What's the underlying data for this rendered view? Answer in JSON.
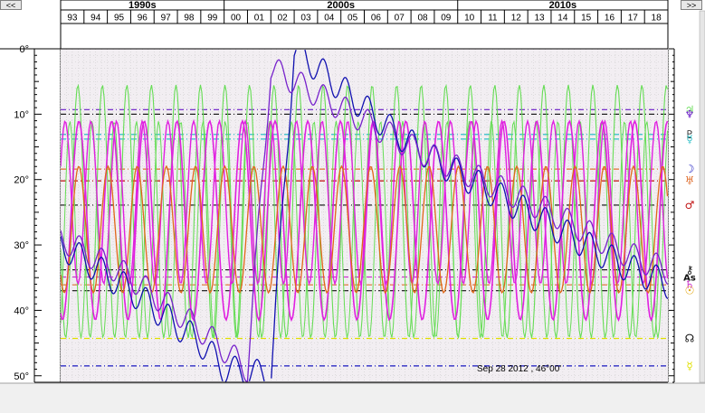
{
  "nav": {
    "prev_label": "<<",
    "next_label": ">>"
  },
  "decades": [
    "1990s",
    "2000s",
    "2010s"
  ],
  "years": [
    "93",
    "94",
    "95",
    "96",
    "97",
    "98",
    "99",
    "00",
    "01",
    "02",
    "03",
    "04",
    "05",
    "06",
    "07",
    "08",
    "09",
    "10",
    "11",
    "12",
    "13",
    "14",
    "15",
    "16",
    "17",
    "18"
  ],
  "status_text": "Sep 28 2012 ,  46°00'",
  "colors": {
    "plot_bg": "#f2eef2",
    "grid": "#c8c8c8",
    "magenta": "#e020e0",
    "orange": "#e06818",
    "green": "#66dd55",
    "blue": "#1010b0",
    "purple": "#7722cc"
  },
  "chart_data": {
    "type": "line",
    "x_range": [
      1993,
      2019
    ],
    "ylim": [
      0,
      51
    ],
    "y_ticks": [
      0,
      10,
      20,
      30,
      40,
      50
    ],
    "y_tick_labels": [
      "0°",
      "10°",
      "20°",
      "30°",
      "40°",
      "50°"
    ],
    "horizontal_lines": [
      {
        "value": 9.3,
        "color": "#6a1ac8",
        "glyph": "♃",
        "glyph_color": "#66dd55"
      },
      {
        "value": 10.0,
        "color": "#202020",
        "glyph": "♆",
        "glyph_color": "#6a1ac8"
      },
      {
        "value": 13.1,
        "color": "#30c0c8",
        "glyph": "♇",
        "glyph_color": "#222222"
      },
      {
        "value": 13.8,
        "color": "#30c0c8",
        "glyph": "☿",
        "glyph_color": "#30c0c8"
      },
      {
        "value": 18.4,
        "color": "#e07030",
        "glyph": "☽",
        "glyph_color": "#1818c0"
      },
      {
        "value": 20.2,
        "color": "#c01010",
        "glyph": "♅",
        "glyph_color": "#e07030"
      },
      {
        "value": 23.9,
        "color": "#111111",
        "glyph": "♂",
        "glyph_color": "#c01010"
      },
      {
        "value": 33.8,
        "color": "#111111",
        "glyph": "⚷",
        "glyph_color": "#111111"
      },
      {
        "value": 34.9,
        "color": "#cc33cc",
        "glyph": "As",
        "glyph_color": "#111111"
      },
      {
        "value": 36.1,
        "color": "#e07030",
        "glyph": "♄",
        "glyph_color": "#cc33cc"
      },
      {
        "value": 37.0,
        "color": "#111111",
        "glyph": "☉",
        "glyph_color": "#e0a000"
      },
      {
        "value": 44.3,
        "color": "#e0e000",
        "glyph": "☊",
        "glyph_color": "#111111"
      },
      {
        "value": 48.5,
        "color": "#1818c0",
        "glyph": "☿",
        "glyph_color": "#e0e000"
      }
    ],
    "series": [
      {
        "color": "#1010b0",
        "trend": [
          [
            1993,
            30
          ],
          [
            1996,
            37
          ],
          [
            1999,
            45
          ],
          [
            2000,
            49
          ],
          [
            2002,
            50
          ],
          [
            2003,
            0
          ],
          [
            2005,
            6
          ],
          [
            2007,
            12
          ],
          [
            2009,
            17
          ],
          [
            2011,
            21
          ],
          [
            2014,
            27
          ],
          [
            2017,
            33
          ],
          [
            2019,
            36
          ]
        ],
        "wiggle": 2.2,
        "period": 0.95
      },
      {
        "color": "#7722cc",
        "trend": [
          [
            1993,
            29
          ],
          [
            1996,
            35
          ],
          [
            1999,
            43
          ],
          [
            2001,
            49
          ],
          [
            2002,
            3
          ],
          [
            2005,
            9
          ],
          [
            2008,
            15
          ],
          [
            2011,
            20
          ],
          [
            2014,
            25
          ],
          [
            2017,
            31
          ],
          [
            2019,
            34
          ]
        ],
        "wiggle": 2.0,
        "period": 0.95
      }
    ],
    "status": "Sep 28 2012 ,  46°00'"
  }
}
